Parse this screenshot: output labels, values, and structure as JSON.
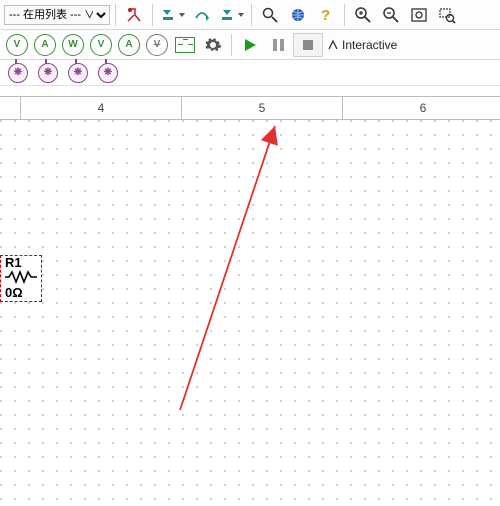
{
  "toolbar1": {
    "dropdown_label": "--- 在用列表 --- ∨",
    "icons": [
      "break-icon",
      "step-in-icon",
      "step-over-icon",
      "step-out-icon",
      "find-icon",
      "globe-icon",
      "help-icon",
      "zoom-in-icon",
      "zoom-out-icon",
      "zoom-fit-icon",
      "zoom-selection-icon"
    ]
  },
  "toolbar2": {
    "meters": [
      "V",
      "A",
      "W",
      "V+",
      "A*",
      "V-",
      "pulse"
    ],
    "gear": "settings-icon",
    "play": "run-icon",
    "pause": "pause-icon",
    "stop": "stop-icon",
    "sim_mode_label": "Interactive"
  },
  "probes": [
    "ϕ",
    "ϕ",
    "ϕ",
    "ϕ"
  ],
  "ruler": {
    "segments": [
      "4",
      "5",
      "6"
    ]
  },
  "component": {
    "ref": "R1",
    "value": "0Ω"
  },
  "colors": {
    "accent_green": "#15a015",
    "accent_red": "#d00000",
    "icon_blue": "#2a5db0",
    "icon_teal": "#1f8f8f",
    "arrow": "#e53030"
  }
}
